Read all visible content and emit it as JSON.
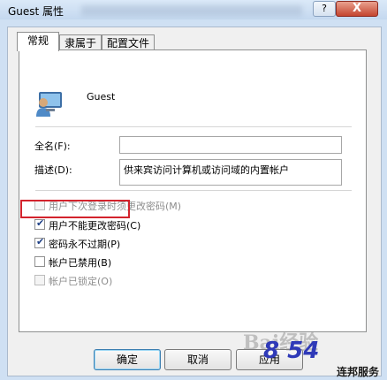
{
  "window": {
    "title": "Guest 属性",
    "help_label": "?",
    "close_label": "X"
  },
  "tabs": [
    {
      "label": "常规",
      "active": true
    },
    {
      "label": "隶属于",
      "active": false
    },
    {
      "label": "配置文件",
      "active": false
    }
  ],
  "account": {
    "username": "Guest",
    "icon": "user-account-icon"
  },
  "fields": {
    "fullname_label": "全名(F):",
    "fullname_value": "",
    "description_label": "描述(D):",
    "description_value": "供来宾访问计算机或访问域的内置帐户"
  },
  "checkboxes": [
    {
      "label": "用户下次登录时须更改密码(M)",
      "checked": false,
      "enabled": false
    },
    {
      "label": "用户不能更改密码(C)",
      "checked": true,
      "enabled": true
    },
    {
      "label": "密码永不过期(P)",
      "checked": true,
      "enabled": true
    },
    {
      "label": "帐户已禁用(B)",
      "checked": false,
      "enabled": true
    },
    {
      "label": "帐户已锁定(O)",
      "checked": false,
      "enabled": false
    }
  ],
  "checkmark": "✔",
  "buttons": {
    "ok": "确定",
    "cancel": "取消",
    "apply": "应用"
  },
  "watermark": "Bai经验",
  "site": {
    "logo_text": "8 54",
    "name": "连邦服务"
  }
}
